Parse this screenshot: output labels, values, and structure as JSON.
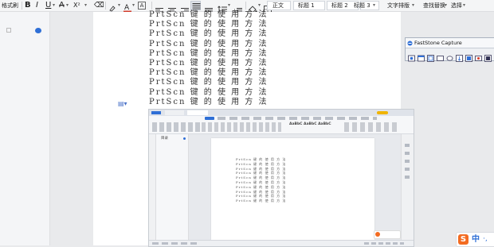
{
  "toolbar": {
    "style_label": "格式刷",
    "bold": "B",
    "italic": "I",
    "underline": "U",
    "strike": "A",
    "super_sub": "X²",
    "font_color": "A",
    "normal_style": "正文",
    "heading1": "标题 1",
    "heading2": "标题 2",
    "heading3": "标题 3",
    "text_layout": "文字排版",
    "find_replace": "查找替换",
    "select": "选择"
  },
  "document": {
    "lines": [
      "PrtScn 键 的 使 用 方 法",
      "PrtScn 键 的 使 用 方 法",
      "PrtScn 键 的 使 用 方 法",
      "PrtScn 键 的 使 用 方 法",
      "PrtScn 键 的 使 用 方 法",
      "PrtScn 键 的 使 用 方 法",
      "PrtScn 键 的 使 用 方 法",
      "PrtScn 键 的 使 用 方 法",
      "PrtScn 键 的 使 用 方 法",
      "PrtScn 键 的 使 用 方 法"
    ]
  },
  "capture": {
    "title": "FastStone Capture"
  },
  "screenshot": {
    "nav_title": "目录",
    "style_preview": "AaBbC AaBbC AaBbC",
    "lines": [
      "PrtScn 键 的 使 用 方 法",
      "PrtScn 键 的 使 用 方 法",
      "PrtScn 键 的 使 用 方 法",
      "PrtScn 键 的 使 用 方 法",
      "PrtScn 键 的 使 用 方 法",
      "PrtScn 键 的 使 用 方 法",
      "PrtScn 键 的 使 用 方 法",
      "PrtScn 键 的 使 用 方 法",
      "PrtScn 键 的 使 用 方 法",
      "PrtScn 键 的 使 用 方 法"
    ]
  },
  "ime": {
    "logo": "S",
    "mode": "中",
    "punct": "·,"
  },
  "colors": {
    "accent": "#2f6fd6",
    "highlight_yellow": "#f5d100",
    "font_red": "#d23b2b",
    "ime_orange": "#f36b21"
  }
}
